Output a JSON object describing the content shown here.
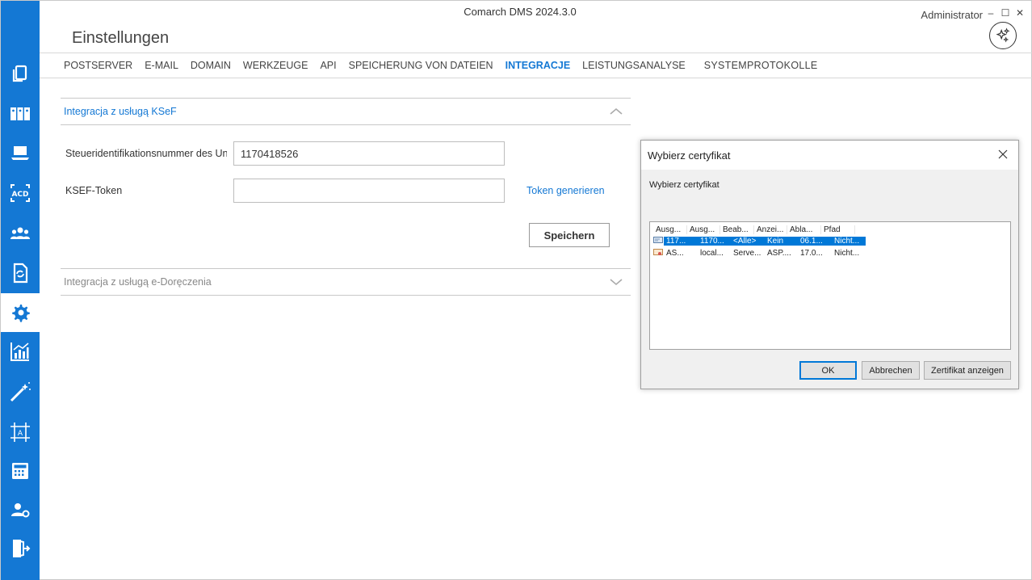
{
  "window": {
    "title": "Comarch DMS 2024.3.0",
    "user": "Administrator",
    "controls": {
      "minimize": "–",
      "maximize": "☐",
      "close": "✕"
    }
  },
  "page": {
    "title": "Einstellungen"
  },
  "tabs": [
    {
      "label": "POSTSERVER"
    },
    {
      "label": "E-MAIL"
    },
    {
      "label": "DOMAIN"
    },
    {
      "label": "WERKZEUGE"
    },
    {
      "label": "API"
    },
    {
      "label": "SPEICHERUNG VON DATEIEN"
    },
    {
      "label": "INTEGRACJE",
      "active": true
    },
    {
      "label": "LEISTUNGSANALYSE"
    },
    {
      "label": "SYSTEMPROTOKOLLE"
    }
  ],
  "sidebar": {
    "accent": "#1478d4",
    "items": [
      {
        "icon": "documents-icon"
      },
      {
        "icon": "binders-icon"
      },
      {
        "icon": "laptop-icon"
      },
      {
        "icon": "acd-icon"
      },
      {
        "icon": "users-icon"
      },
      {
        "icon": "document-sync-icon"
      },
      {
        "icon": "gear-icon",
        "active": true
      },
      {
        "icon": "analytics-chart-icon"
      },
      {
        "icon": "magic-wand-icon"
      },
      {
        "icon": "template-frame-icon"
      },
      {
        "icon": "calculator-icon"
      },
      {
        "icon": "user-settings-icon"
      },
      {
        "icon": "logout-door-icon"
      }
    ]
  },
  "sections": {
    "ksef": {
      "title": "Integracja z usługą KSeF",
      "expanded": true
    },
    "edoreczenia": {
      "title": "Integracja z usługą e-Doręczenia",
      "expanded": false
    }
  },
  "form": {
    "nip_label": "Steueridentifikationsnummer des Unternehmens",
    "nip_value": "1170418526",
    "token_label": "KSEF-Token",
    "token_value": "",
    "token_link": "Token generieren",
    "save_label": "Speichern"
  },
  "dialog": {
    "title": "Wybierz certyfikat",
    "subtitle": "Wybierz certyfikat",
    "close": "✕",
    "columns": [
      "Ausg...",
      "Ausg...",
      "Beab...",
      "Anzei...",
      "Abla...",
      "Pfad"
    ],
    "rows": [
      {
        "cells": [
          "117...",
          "1170...",
          "<Alle>",
          "Kein",
          "06.1...",
          "Nicht..."
        ],
        "selected": true
      },
      {
        "cells": [
          "AS...",
          "local...",
          "Serve...",
          "ASP....",
          "17.0...",
          "Nicht..."
        ],
        "selected": false
      }
    ],
    "ok_label": "OK",
    "cancel_label": "Abbrechen",
    "view_label": "Zertifikat anzeigen"
  }
}
